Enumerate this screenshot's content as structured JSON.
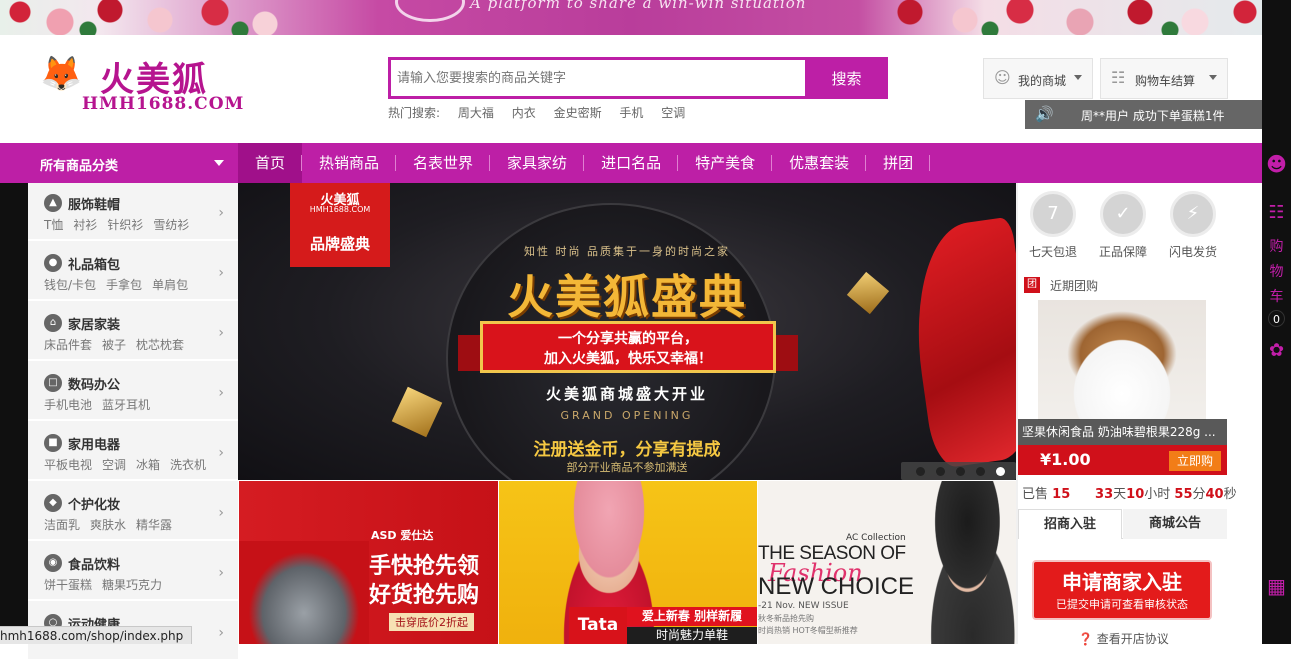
{
  "top_banner": {
    "slogan": "A platform to share a win-win situation"
  },
  "logo": {
    "name_cn": "火美狐",
    "name_en": "HMH1688.COM",
    "fox_glyph": "🦊"
  },
  "search": {
    "placeholder": "请输入您要搜索的商品关键字",
    "button": "搜索",
    "hot_label": "热门搜索:",
    "hot_keywords": [
      "周大福",
      "内衣",
      "金史密斯",
      "手机",
      "空调"
    ]
  },
  "header": {
    "my_mall": "我的商城",
    "cart_checkout": "购物车结算"
  },
  "notice": {
    "text": "周**用户 成功下单蛋糕1件"
  },
  "nav": {
    "all_categories": "所有商品分类",
    "items": [
      "首页",
      "热销商品",
      "名表世界",
      "家具家纺",
      "进口名品",
      "特产美食",
      "优惠套装",
      "拼团"
    ]
  },
  "categories": [
    {
      "name": "服饰鞋帽",
      "icon": "shirt-icon",
      "subs": [
        "T恤",
        "衬衫",
        "针织衫",
        "雪纺衫"
      ]
    },
    {
      "name": "礼品箱包",
      "icon": "bag-icon",
      "subs": [
        "钱包/卡包",
        "手拿包",
        "单肩包"
      ]
    },
    {
      "name": "家居家装",
      "icon": "home-icon",
      "subs": [
        "床品件套",
        "被子",
        "枕芯枕套"
      ]
    },
    {
      "name": "数码办公",
      "icon": "phone-icon",
      "subs": [
        "手机电池",
        "蓝牙耳机"
      ]
    },
    {
      "name": "家用电器",
      "icon": "appliance-icon",
      "subs": [
        "平板电视",
        "空调",
        "冰箱",
        "洗衣机"
      ]
    },
    {
      "name": "个护化妆",
      "icon": "cosmetics-icon",
      "subs": [
        "洁面乳",
        "爽肤水",
        "精华露"
      ]
    },
    {
      "name": "食品饮料",
      "icon": "food-icon",
      "subs": [
        "饼干蛋糕",
        "糖果巧克力"
      ]
    },
    {
      "name": "运动健康",
      "icon": "sport-icon",
      "subs": []
    }
  ],
  "main_banner": {
    "tag_logo": "火美狐",
    "tag_site": "HMH1688.COM",
    "tag_label": "品牌盛典",
    "tagline": "知性 时尚 品质集于一身的时尚之家",
    "title": "火美狐盛典",
    "ribbon_line1": "一个分享共赢的平台，",
    "ribbon_line2": "加入火美狐，快乐又幸福！",
    "opening": "火美狐商城盛大开业",
    "grand": "GRAND OPENING",
    "gift": "注册送金币，分享有提成",
    "note": "部分开业商品不参加满送",
    "dots": 5,
    "active_dot": 5
  },
  "sub_banners": {
    "cookware": {
      "brand": "ASD 爱仕达",
      "line1": "手快抢先领",
      "line2": "好货抢先购",
      "tag": "击穿底价2折起"
    },
    "shoes": {
      "brand": "Tata",
      "line1": "爱上新春 别样新履",
      "line2": "时尚魅力单鞋"
    },
    "fashion": {
      "ac": "AC Collection",
      "line1": "THE SEASON OF",
      "line2": "Fashion",
      "line3": "NEW CHOICE",
      "line4": "-21 Nov. NEW ISSUE",
      "line5": "秋冬新品抢先购",
      "line6": "时尚热销 HOT冬帽型新推荐"
    }
  },
  "services": [
    {
      "label": "七天包退",
      "icon": "seven-day-icon",
      "glyph": "7"
    },
    {
      "label": "正品保障",
      "icon": "shield-icon",
      "glyph": "✓"
    },
    {
      "label": "闪电发货",
      "icon": "truck-icon",
      "glyph": "⚡"
    }
  ],
  "group_buy": {
    "badge": "团",
    "title": "近期团购",
    "product_name": "坚果休闲食品 奶油味碧根果228g ...",
    "price": "¥1.00",
    "buy_button": "立即购",
    "sold_label": "已售",
    "sold": "15",
    "days": "33",
    "days_unit": "天",
    "hours": "10",
    "hours_unit": "小时",
    "minutes": "55",
    "minutes_unit": "分",
    "seconds": "40",
    "seconds_unit": "秒"
  },
  "info_tabs": [
    "招商入驻",
    "商城公告"
  ],
  "apply": {
    "title": "申请商家入驻",
    "sub": "已提交申请可查看审核状态"
  },
  "agreement": "查看开店协议",
  "sidebar": {
    "cart_label": [
      "购",
      "物",
      "车"
    ],
    "cart_count": "0"
  },
  "status_url": "hmh1688.com/shop/index.php",
  "colors": {
    "brand": "#bd1fa6",
    "red": "#d0101a"
  }
}
